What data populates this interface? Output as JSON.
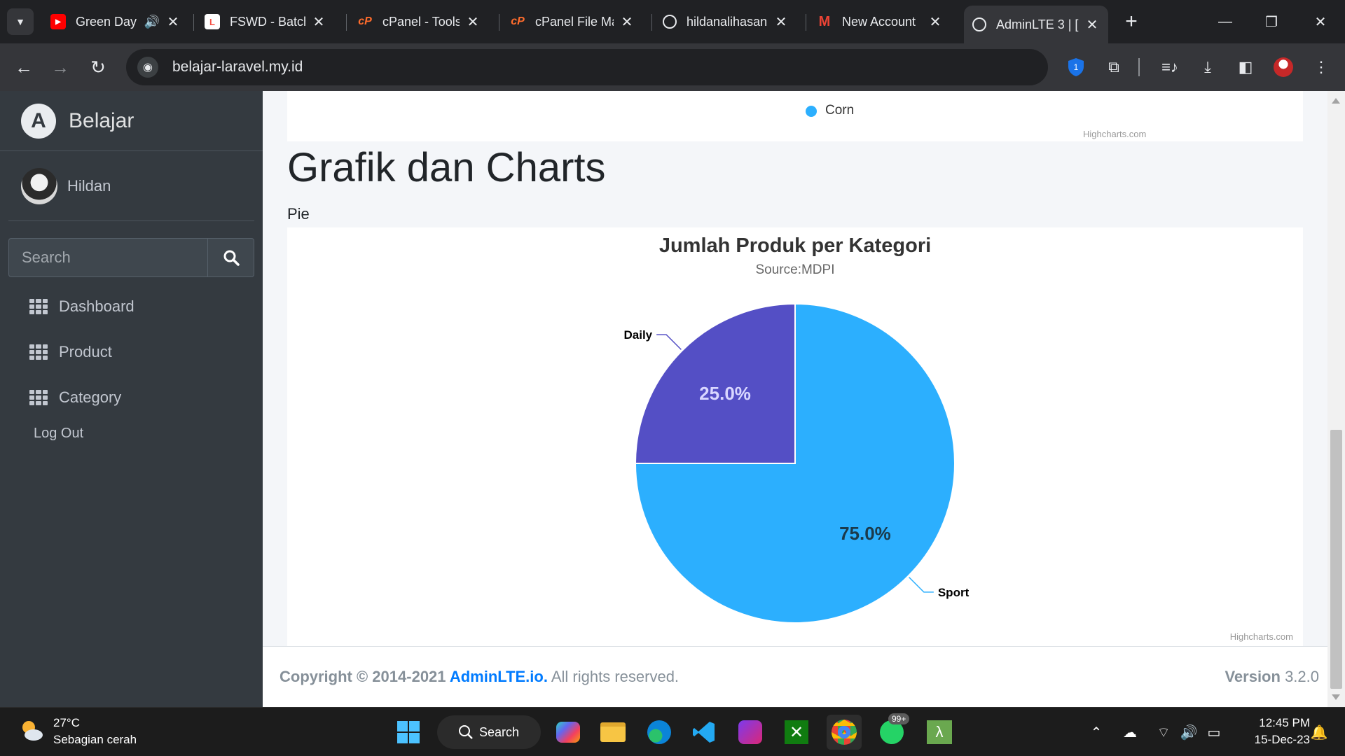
{
  "browser": {
    "tabs": [
      {
        "label": "Green Day",
        "favicon": "youtube-icon",
        "sound": true
      },
      {
        "label": "FSWD - Batch",
        "favicon": "laravel-icon"
      },
      {
        "label": "cPanel - Tools",
        "favicon": "cpanel-icon"
      },
      {
        "label": "cPanel File Ma",
        "favicon": "cpanel-icon"
      },
      {
        "label": "hildanalihasan",
        "favicon": "globe-icon"
      },
      {
        "label": "New Account",
        "favicon": "gmail-icon"
      },
      {
        "label": "AdminLTE 3 | [",
        "favicon": "globe-icon",
        "active": true
      }
    ],
    "url": "belajar-laravel.my.id",
    "extension_badge": "1"
  },
  "sidebar": {
    "brand": "Belajar",
    "brand_logo": "A",
    "user": "Hildan",
    "search_placeholder": "Search",
    "items": [
      {
        "label": "Dashboard"
      },
      {
        "label": "Product"
      },
      {
        "label": "Category"
      }
    ],
    "logout": "Log Out"
  },
  "content": {
    "previous_chart_legend": "Corn",
    "previous_chart_credit": "Highcharts.com",
    "page_title": "Grafik dan Charts",
    "section": "Pie",
    "chart_credit": "Highcharts.com"
  },
  "chart_data": {
    "type": "pie",
    "title": "Jumlah Produk per Kategori",
    "subtitle": "Source:MDPI",
    "slices": [
      {
        "name": "Sport",
        "value": 75.0,
        "label": "75.0%",
        "color": "#2caffe"
      },
      {
        "name": "Daily",
        "value": 25.0,
        "label": "25.0%",
        "color": "#544fc5"
      }
    ]
  },
  "footer": {
    "copyright_prefix": "Copyright © 2014-2021 ",
    "brand": "AdminLTE.io.",
    "suffix": " All rights reserved.",
    "version_label": "Version",
    "version": "3.2.0"
  },
  "taskbar": {
    "temperature": "27°C",
    "weather": "Sebagian cerah",
    "search": "Search",
    "whatsapp_badge": "99+",
    "time": "12:45 PM",
    "date": "15-Dec-23"
  }
}
